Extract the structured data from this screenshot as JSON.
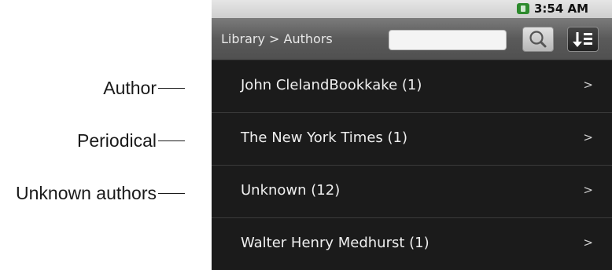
{
  "callouts": [
    {
      "label": "Author"
    },
    {
      "label": "Periodical"
    },
    {
      "label": "Unknown authors"
    }
  ],
  "status": {
    "time": "3:54 AM",
    "battery_icon": "battery-icon"
  },
  "header": {
    "breadcrumb": "Library > Authors",
    "search_placeholder": "",
    "search_icon": "search-icon",
    "sort_icon": "sort-icon"
  },
  "list": {
    "items": [
      {
        "label": "John ClelandBookkake (1)",
        "arrow": ">"
      },
      {
        "label": "The New York Times (1)",
        "arrow": ">"
      },
      {
        "label": "Unknown (12)",
        "arrow": ">"
      },
      {
        "label": "Walter Henry Medhurst (1)",
        "arrow": ">"
      }
    ]
  }
}
